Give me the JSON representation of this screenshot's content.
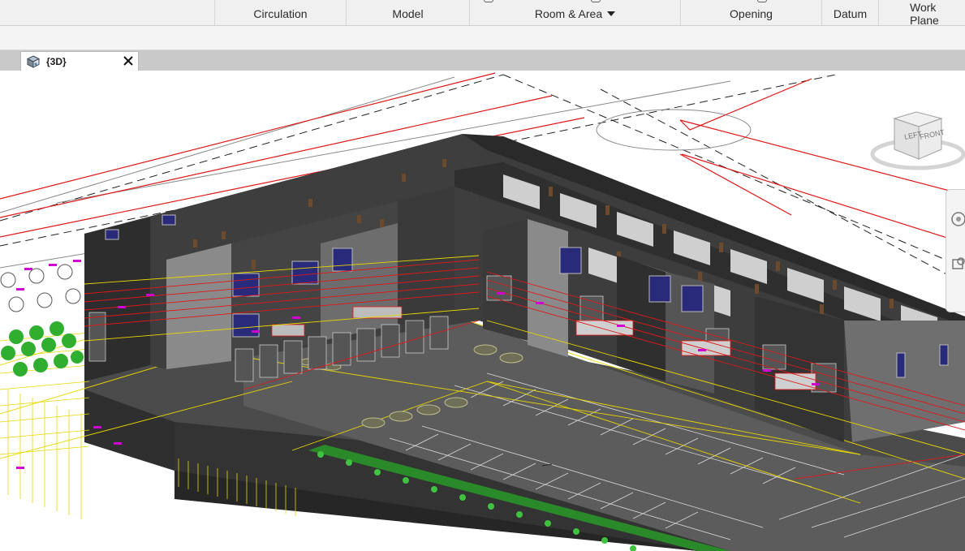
{
  "ribbon": {
    "panels": [
      {
        "label": "Circulation",
        "has_dropdown": false
      },
      {
        "label": "Model",
        "has_dropdown": false
      },
      {
        "label": "Room & Area",
        "has_dropdown": true
      },
      {
        "label": "Opening",
        "has_dropdown": false
      },
      {
        "label": "Datum",
        "has_dropdown": false
      },
      {
        "label": "Work Plane",
        "has_dropdown": false
      }
    ]
  },
  "view_tab": {
    "icon": "3d-view-icon",
    "title": "{3D}",
    "close_icon": "close-icon"
  },
  "viewcube": {
    "faces": {
      "left": "LEFT",
      "front": "FRONT"
    }
  },
  "navigation_bar": {
    "items": [
      "full-navigation-wheel-icon",
      "zoom-region-icon"
    ]
  },
  "colors": {
    "ribbon_bg": "#f0f0f0",
    "tabbar_bg": "#c9c9c9",
    "wall_dark": "#3a3a3a",
    "wall_light": "#d0d0d0",
    "parking_surface": "#5a5a5a",
    "property_line": "#e01818",
    "grid_line": "#e8d800",
    "tag_magenta": "#d000d0",
    "planting": "#28a828"
  }
}
